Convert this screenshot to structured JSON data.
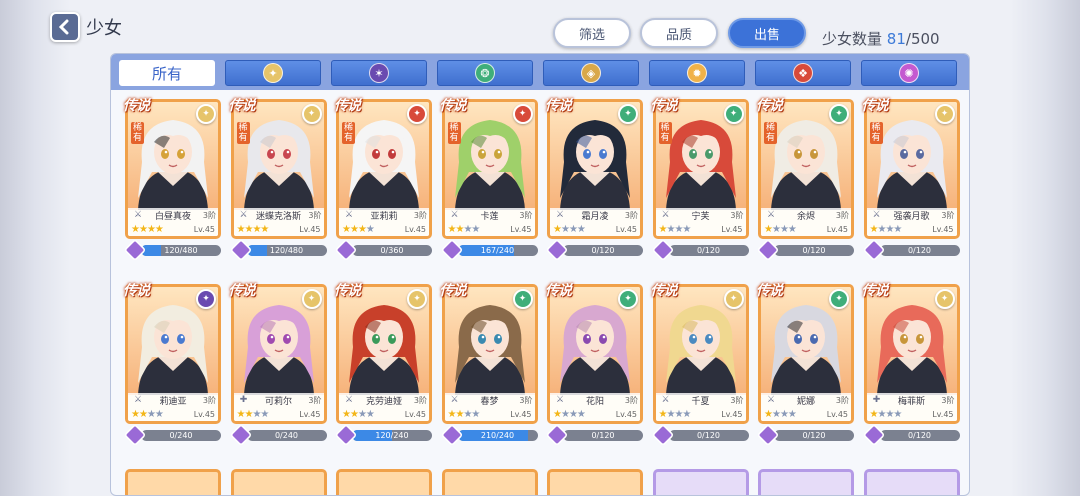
{
  "header": {
    "title": "少女",
    "filter_label": "筛选",
    "quality_label": "品质",
    "sell_label": "出售",
    "count_label": "少女数量",
    "count_current": "81",
    "count_max": "/500"
  },
  "tabs": [
    {
      "label": "所有",
      "icon": "all",
      "color": ""
    },
    {
      "label": "",
      "icon": "light-element-icon",
      "color": "#e6c46a"
    },
    {
      "label": "",
      "icon": "dark-element-icon",
      "color": "#6a4ab0"
    },
    {
      "label": "",
      "icon": "wind-element-icon",
      "color": "#3fae7a"
    },
    {
      "label": "",
      "icon": "earth-element-icon",
      "color": "#d9a84a"
    },
    {
      "label": "",
      "icon": "sun-element-icon",
      "color": "#f0b24a"
    },
    {
      "label": "",
      "icon": "fire-element-icon",
      "color": "#d84a3a"
    },
    {
      "label": "",
      "icon": "spirit-element-icon",
      "color": "#c45ad0"
    }
  ],
  "legend_tag": "传说",
  "cards": [
    {
      "name": "白昼真夜",
      "rank": "3阶",
      "level": "Lv.45",
      "stars": 4,
      "sub": "稀有",
      "element": "#e6c46a",
      "class": "⚔",
      "frag": "120/480",
      "frag_pct": 0.25,
      "hair": "#f2f2f2",
      "hair2": "#2a2a2a",
      "eye": "#d6a238"
    },
    {
      "name": "迷蝶克洛斯",
      "rank": "3阶",
      "level": "Lv.45",
      "stars": 4,
      "sub": "稀有",
      "element": "#e6c46a",
      "class": "⚔",
      "frag": "120/480",
      "frag_pct": 0.25,
      "hair": "#e8e8ec",
      "hair2": "#c8c8d0",
      "eye": "#c8464f"
    },
    {
      "name": "亚莉莉",
      "rank": "3阶",
      "level": "Lv.45",
      "stars": 3,
      "sub": "稀有",
      "element": "#d84a3a",
      "class": "⚔",
      "frag": "0/360",
      "frag_pct": 0,
      "hair": "#f5f5f5",
      "hair2": "#e0e0e0",
      "eye": "#c23a3a"
    },
    {
      "name": "卡莲",
      "rank": "3阶",
      "level": "Lv.45",
      "stars": 2,
      "sub": "稀有",
      "element": "#d84a3a",
      "class": "⚔",
      "frag": "167/240",
      "frag_pct": 0.7,
      "hair": "#9fd06a",
      "hair2": "#5a8a3a",
      "eye": "#caa43a"
    },
    {
      "name": "霜月凌",
      "rank": "3阶",
      "level": "Lv.45",
      "stars": 1,
      "sub": "",
      "element": "#3fae7a",
      "class": "⚔",
      "frag": "0/120",
      "frag_pct": 0,
      "hair": "#222a3a",
      "hair2": "#3a5a9a",
      "eye": "#4a7ad0"
    },
    {
      "name": "宁芙",
      "rank": "3阶",
      "level": "Lv.45",
      "stars": 1,
      "sub": "稀有",
      "element": "#3fae7a",
      "class": "⚔",
      "frag": "0/120",
      "frag_pct": 0,
      "hair": "#d84a3a",
      "hair2": "#a83a2a",
      "eye": "#4a9a6a"
    },
    {
      "name": "余烬",
      "rank": "3阶",
      "level": "Lv.45",
      "stars": 1,
      "sub": "稀有",
      "element": "#3fae7a",
      "class": "⚔",
      "frag": "0/120",
      "frag_pct": 0,
      "hair": "#f0ece4",
      "hair2": "#d8d0c0",
      "eye": "#c8963a"
    },
    {
      "name": "强袭月歌",
      "rank": "3阶",
      "level": "Lv.45",
      "stars": 1,
      "sub": "稀有",
      "element": "#e6c46a",
      "class": "⚔",
      "frag": "0/120",
      "frag_pct": 0,
      "hair": "#eaeaf0",
      "hair2": "#c8c8d4",
      "eye": "#5a6aa0"
    },
    {
      "name": "莉迪亚",
      "rank": "3阶",
      "level": "Lv.45",
      "stars": 2,
      "sub": "",
      "element": "#6a4ab0",
      "class": "⚔",
      "frag": "0/240",
      "frag_pct": 0,
      "hair": "#f2ede0",
      "hair2": "#d8d0b8",
      "eye": "#4a7ad0"
    },
    {
      "name": "可莉尔",
      "rank": "3阶",
      "level": "Lv.45",
      "stars": 2,
      "sub": "",
      "element": "#e6c46a",
      "class": "✚",
      "frag": "0/240",
      "frag_pct": 0,
      "hair": "#d8a0d8",
      "hair2": "#b87ab8",
      "eye": "#a04ab0"
    },
    {
      "name": "克劳迪娅",
      "rank": "3阶",
      "level": "Lv.45",
      "stars": 2,
      "sub": "",
      "element": "#e6c46a",
      "class": "⚔",
      "frag": "120/240",
      "frag_pct": 0.5,
      "hair": "#c8402a",
      "hair2": "#8a2a1a",
      "eye": "#3a9a5a"
    },
    {
      "name": "春梦",
      "rank": "3阶",
      "level": "Lv.45",
      "stars": 2,
      "sub": "",
      "element": "#3fae7a",
      "class": "⚔",
      "frag": "210/240",
      "frag_pct": 0.875,
      "hair": "#8a6a4a",
      "hair2": "#6a4a2a",
      "eye": "#3a8ab0"
    },
    {
      "name": "花阳",
      "rank": "3阶",
      "level": "Lv.45",
      "stars": 1,
      "sub": "",
      "element": "#3fae7a",
      "class": "⚔",
      "frag": "0/120",
      "frag_pct": 0,
      "hair": "#d8a8d0",
      "hair2": "#b888b0",
      "eye": "#8a4ab0"
    },
    {
      "name": "千夏",
      "rank": "3阶",
      "level": "Lv.45",
      "stars": 1,
      "sub": "",
      "element": "#e6c46a",
      "class": "⚔",
      "frag": "0/120",
      "frag_pct": 0,
      "hair": "#f0d890",
      "hair2": "#d8b860",
      "eye": "#4a8ac0"
    },
    {
      "name": "妮娜",
      "rank": "3阶",
      "level": "Lv.45",
      "stars": 1,
      "sub": "",
      "element": "#3fae7a",
      "class": "⚔",
      "frag": "0/120",
      "frag_pct": 0,
      "hair": "#d8d8e0",
      "hair2": "#2a2a30",
      "eye": "#4a6ab0"
    },
    {
      "name": "梅菲斯",
      "rank": "3阶",
      "level": "Lv.45",
      "stars": 1,
      "sub": "",
      "element": "#e6c46a",
      "class": "✚",
      "frag": "0/120",
      "frag_pct": 0,
      "hair": "#e86a5a",
      "hair2": "#c84a3a",
      "eye": "#c8963a"
    }
  ]
}
